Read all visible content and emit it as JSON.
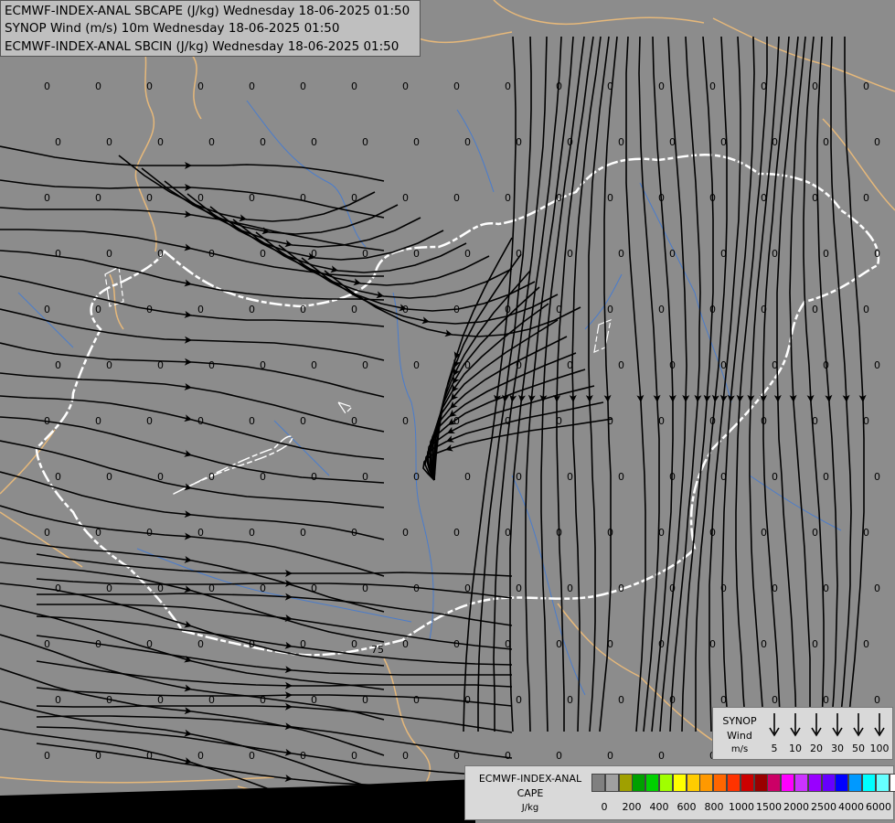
{
  "titles": [
    "ECMWF-INDEX-ANAL SBCAPE (J/kg) Wednesday 18-06-2025 01:50",
    "SYNOP Wind (m/s) 10m Wednesday 18-06-2025 01:50",
    "ECMWF-INDEX-ANAL SBCIN (J/kg) Wednesday 18-06-2025 01:50"
  ],
  "colors": {
    "background": "#8c8c8c",
    "border_country": "#ffffff",
    "border_region": "#e6b87a",
    "river": "#4a7ccc",
    "streamline": "#000000"
  },
  "grid": {
    "value": "0",
    "special_value": "75",
    "special_note": "single non-zero CAPE value near southern Hungary"
  },
  "synop_legend": {
    "title_lines": [
      "SYNOP",
      "Wind",
      "m/s"
    ],
    "speeds": [
      "5",
      "10",
      "20",
      "30",
      "50",
      "100"
    ]
  },
  "cape_legend": {
    "title_lines": [
      "ECMWF-INDEX-ANAL",
      "CAPE",
      "J/kg"
    ],
    "ticks": [
      "0",
      "200",
      "400",
      "600",
      "800",
      "1000",
      "1500",
      "2000",
      "2500",
      "4000",
      "6000"
    ],
    "swatches": [
      "#808080",
      "#a0a0a0",
      "#a0a000",
      "#00a000",
      "#00d000",
      "#a0ff00",
      "#ffff00",
      "#ffcc00",
      "#ff9900",
      "#ff6600",
      "#ff3300",
      "#cc0000",
      "#990000",
      "#cc0066",
      "#ff00ff",
      "#cc33ff",
      "#9900ff",
      "#6600ff",
      "#0000ff",
      "#0099ff",
      "#00ffff",
      "#66ffff",
      "#ffffff"
    ]
  }
}
